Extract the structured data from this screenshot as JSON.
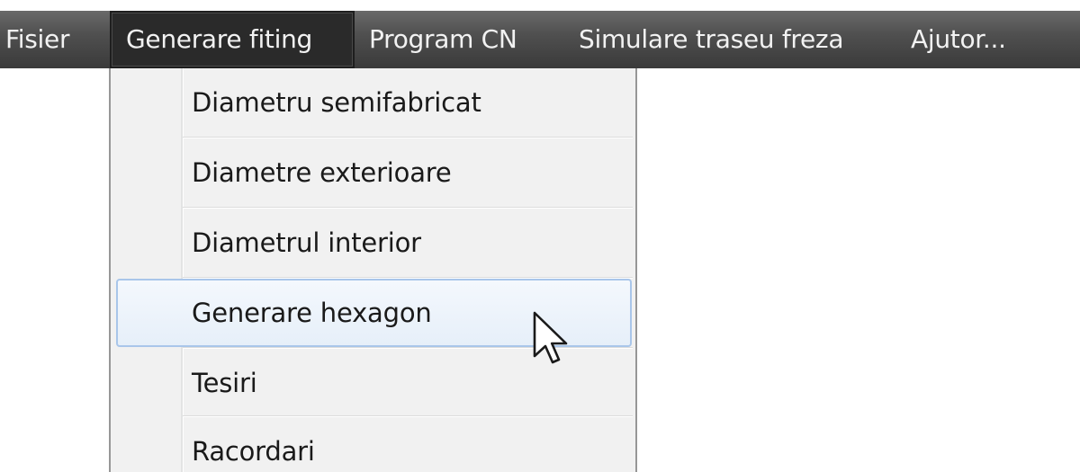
{
  "menubar": {
    "items": [
      {
        "label": "Fisier"
      },
      {
        "label": "Generare fiting"
      },
      {
        "label": "Program CN"
      },
      {
        "label": "Simulare traseu freza"
      },
      {
        "label": "Ajutor..."
      }
    ],
    "active_index": 1
  },
  "dropdown": {
    "items": [
      {
        "label": "Diametru semifabricat"
      },
      {
        "label": "Diametre exterioare"
      },
      {
        "label": "Diametrul interior"
      },
      {
        "label": "Generare hexagon"
      },
      {
        "label": "Tesiri"
      },
      {
        "label": "Racordari"
      }
    ],
    "highlighted_index": 3
  },
  "cursor": {
    "icon": "mouse-pointer-arrow-icon"
  },
  "colors": {
    "menubar_bg": "#505050",
    "menu_bg": "#f1f1f1",
    "highlight_border": "#a9c6ea"
  }
}
